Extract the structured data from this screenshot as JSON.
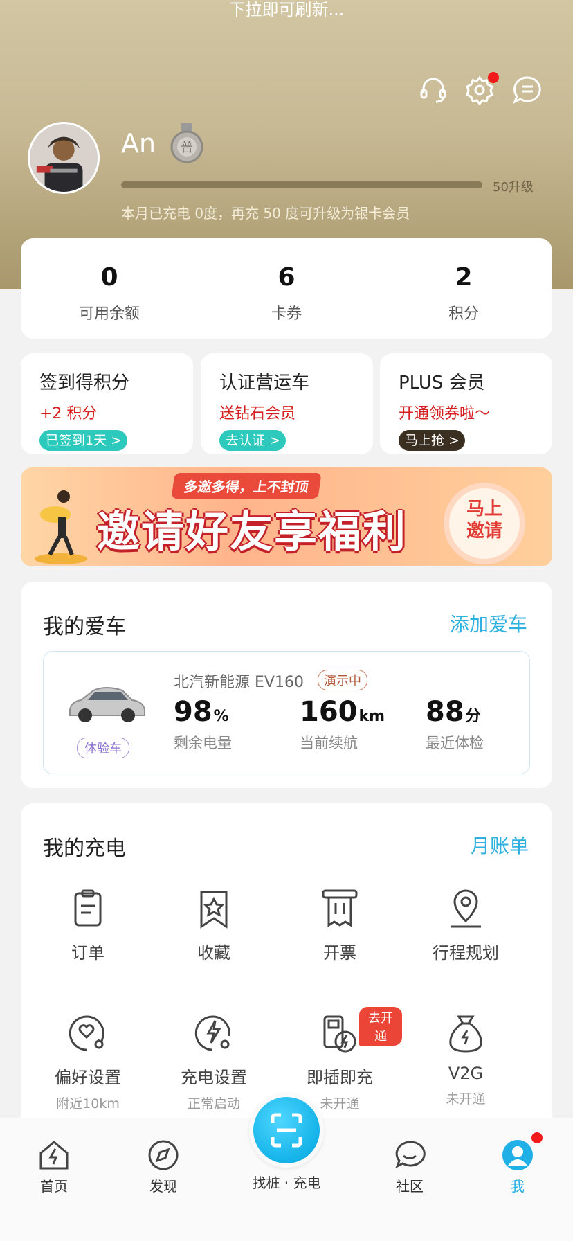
{
  "hero": {
    "pull_hint": "下拉即可刷新...",
    "username": "An",
    "medal_glyph": "普",
    "upgrade_label": "50升级",
    "progress_fraction": 0.0,
    "charge_tip": "本月已充电 0度，再充 50 度可升级为银卡会员"
  },
  "stats": [
    {
      "value": "0",
      "label": "可用余额"
    },
    {
      "value": "6",
      "label": "卡券"
    },
    {
      "value": "2",
      "label": "积分"
    }
  ],
  "promos": [
    {
      "title": "签到得积分",
      "sub": "+2 积分",
      "button": "已签到1天 >"
    },
    {
      "title": "认证营运车",
      "sub": "送钻石会员",
      "button": "去认证 >"
    },
    {
      "title": "PLUS 会员",
      "sub": "开通领券啦～",
      "button": "马上抢 >"
    }
  ],
  "banner": {
    "tag": "多邀多得，上不封顶",
    "title": "邀请好友享福利",
    "cta_line1": "马上",
    "cta_line2": "邀请"
  },
  "car": {
    "section_title": "我的爱车",
    "add_link": "添加爱车",
    "name": "北汽新能源 EV160",
    "demo_badge": "演示中",
    "trial_badge": "体验车",
    "metrics": [
      {
        "value": "98",
        "unit": "%",
        "label": "剩余电量"
      },
      {
        "value": "160",
        "unit": "km",
        "label": "当前续航"
      },
      {
        "value": "88",
        "unit": "分",
        "label": "最近体检"
      }
    ]
  },
  "charging": {
    "section_title": "我的充电",
    "bill_link": "月账单",
    "items": [
      {
        "label": "订单",
        "icon": "clipboard-icon"
      },
      {
        "label": "收藏",
        "icon": "bookmark-star-icon"
      },
      {
        "label": "开票",
        "icon": "receipt-icon"
      },
      {
        "label": "行程规划",
        "icon": "location-pin-icon"
      },
      {
        "label": "偏好设置",
        "sub": "附近10km",
        "icon": "heart-settings-icon"
      },
      {
        "label": "充电设置",
        "sub": "正常启动",
        "icon": "bolt-settings-icon"
      },
      {
        "label": "即插即充",
        "sub": "未开通",
        "tag": "去开通",
        "icon": "plug-charge-icon"
      },
      {
        "label": "V2G",
        "sub": "未开通",
        "icon": "money-bag-icon"
      }
    ]
  },
  "tabbar": {
    "home": "首页",
    "discover": "发现",
    "scan": "找桩 · 充电",
    "community": "社区",
    "me": "我"
  },
  "colors": {
    "accent": "#1eb0e6",
    "red": "#d61f1f",
    "teal": "#2ec9bd",
    "gold_bg": "#c7b994"
  }
}
